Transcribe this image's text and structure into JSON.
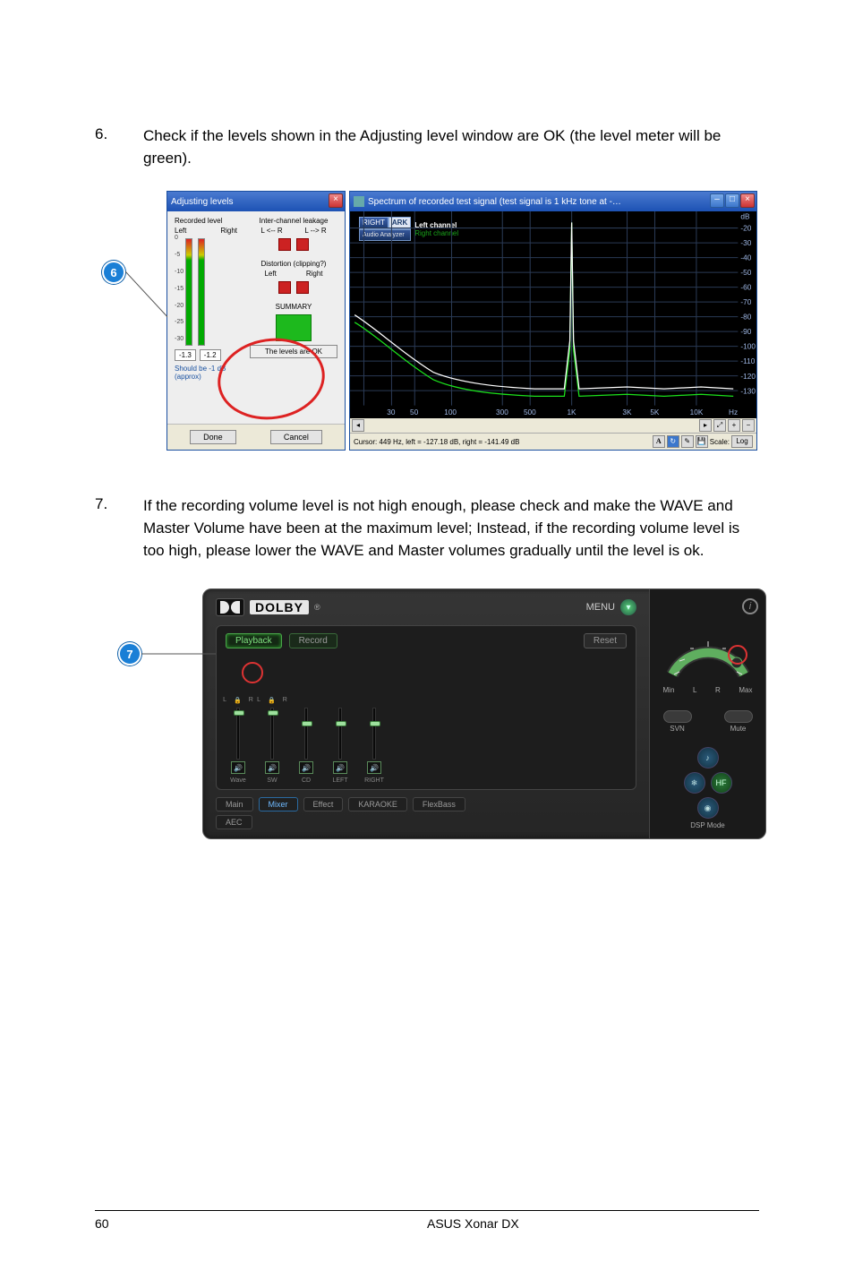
{
  "steps": {
    "s6": {
      "num": "6.",
      "text": "Check if the levels shown in the Adjusting level window are OK (the level meter will be green)."
    },
    "s7": {
      "num": "7.",
      "text": "If the recording volume level is not high enough, please check and make the WAVE and Master Volume have been at the maximum level; Instead, if the recording volume level is too high, please lower the WAVE and Master volumes gradually until the level is ok."
    }
  },
  "callouts": {
    "c6": "6",
    "c7": "7"
  },
  "adjusting": {
    "title": "Adjusting levels",
    "recorded_label": "Recorded level",
    "left": "Left",
    "right": "Right",
    "leakage_label": "Inter-channel leakage",
    "leak_lr": "L <-- R",
    "leak_rl": "L --> R",
    "distortion_label": "Distortion (clipping?)",
    "summary": "SUMMARY",
    "levels_ok": "The levels are OK",
    "val_l": "-1.3",
    "val_r": "-1.2",
    "should_be": "Should be -1 dB",
    "approx": "(approx)",
    "scale": [
      "0",
      "-5",
      "-10",
      "-15",
      "-20",
      "-25",
      "-30"
    ],
    "done": "Done",
    "cancel": "Cancel"
  },
  "spectrum": {
    "title": "Spectrum of recorded test signal (test signal is 1 kHz tone at -…",
    "legend_brand1": "RIGHT",
    "legend_brand2": "ARK",
    "legend_sub": "Audio Analyzer",
    "legend_left": "Left channel",
    "legend_right": "Right channel",
    "db_unit": "dB",
    "y_ticks": [
      "-20",
      "-30",
      "-40",
      "-50",
      "-60",
      "-70",
      "-80",
      "-90",
      "-100",
      "-110",
      "-120",
      "-130"
    ],
    "x_ticks": [
      "30",
      "50",
      "100",
      "300",
      "500",
      "1K",
      "3K",
      "5K",
      "10K"
    ],
    "hz": "Hz",
    "status": "Cursor: 449 Hz, left = -127.18 dB, right = -141.49 dB",
    "scale_lbl": "Scale:",
    "scale_val": "Log",
    "tool_a": "A"
  },
  "dolby": {
    "brand": "DOLBY",
    "reg": "®",
    "menu": "MENU",
    "playback": "Playback",
    "record": "Record",
    "reset": "Reset",
    "channels": {
      "wave": "Wave",
      "sw": "SW",
      "cd": "CD",
      "left": "LEFT",
      "right": "RIGHT",
      "l": "L",
      "r": "R"
    },
    "bottom_tabs": {
      "main": "Main",
      "mixer": "Mixer",
      "effect": "Effect",
      "karaoke": "KARAOKE",
      "flexbass": "FlexBass",
      "aec": "AEC"
    },
    "side": {
      "min": "Min",
      "l": "L",
      "r": "R",
      "max": "Max",
      "svn": "SVN",
      "mute": "Mute",
      "hf": "HF",
      "dsp": "DSP Mode"
    }
  },
  "footer": {
    "page": "60",
    "product": "ASUS Xonar DX"
  },
  "chart_data": {
    "type": "line",
    "title": "Spectrum of recorded test signal (1 kHz tone)",
    "xlabel": "Hz",
    "ylabel": "dB",
    "x_scale": "log",
    "xlim": [
      20,
      20000
    ],
    "ylim": [
      -135,
      -15
    ],
    "x_ticks": [
      30,
      50,
      100,
      300,
      500,
      1000,
      3000,
      5000,
      10000
    ],
    "y_ticks": [
      -20,
      -30,
      -40,
      -50,
      -60,
      -70,
      -80,
      -90,
      -100,
      -110,
      -120,
      -130
    ],
    "series": [
      {
        "name": "Left channel",
        "x": [
          20,
          30,
          50,
          80,
          150,
          300,
          500,
          800,
          950,
          1000,
          1050,
          1200,
          2000,
          3000,
          5000,
          8000,
          10000,
          15000,
          20000
        ],
        "dB": [
          -85,
          -90,
          -100,
          -115,
          -122,
          -125,
          -127,
          -128,
          -100,
          -18,
          -100,
          -128,
          -125,
          -128,
          -125,
          -128,
          -127,
          -128,
          -128
        ]
      },
      {
        "name": "Right channel",
        "x": [
          20,
          30,
          50,
          80,
          150,
          300,
          500,
          800,
          950,
          1000,
          1050,
          1200,
          2000,
          3000,
          5000,
          8000,
          10000,
          15000,
          20000
        ],
        "dB": [
          -88,
          -95,
          -105,
          -118,
          -126,
          -128,
          -130,
          -130,
          -110,
          -18,
          -110,
          -130,
          -128,
          -130,
          -128,
          -130,
          -130,
          -130,
          -130
        ]
      }
    ]
  }
}
